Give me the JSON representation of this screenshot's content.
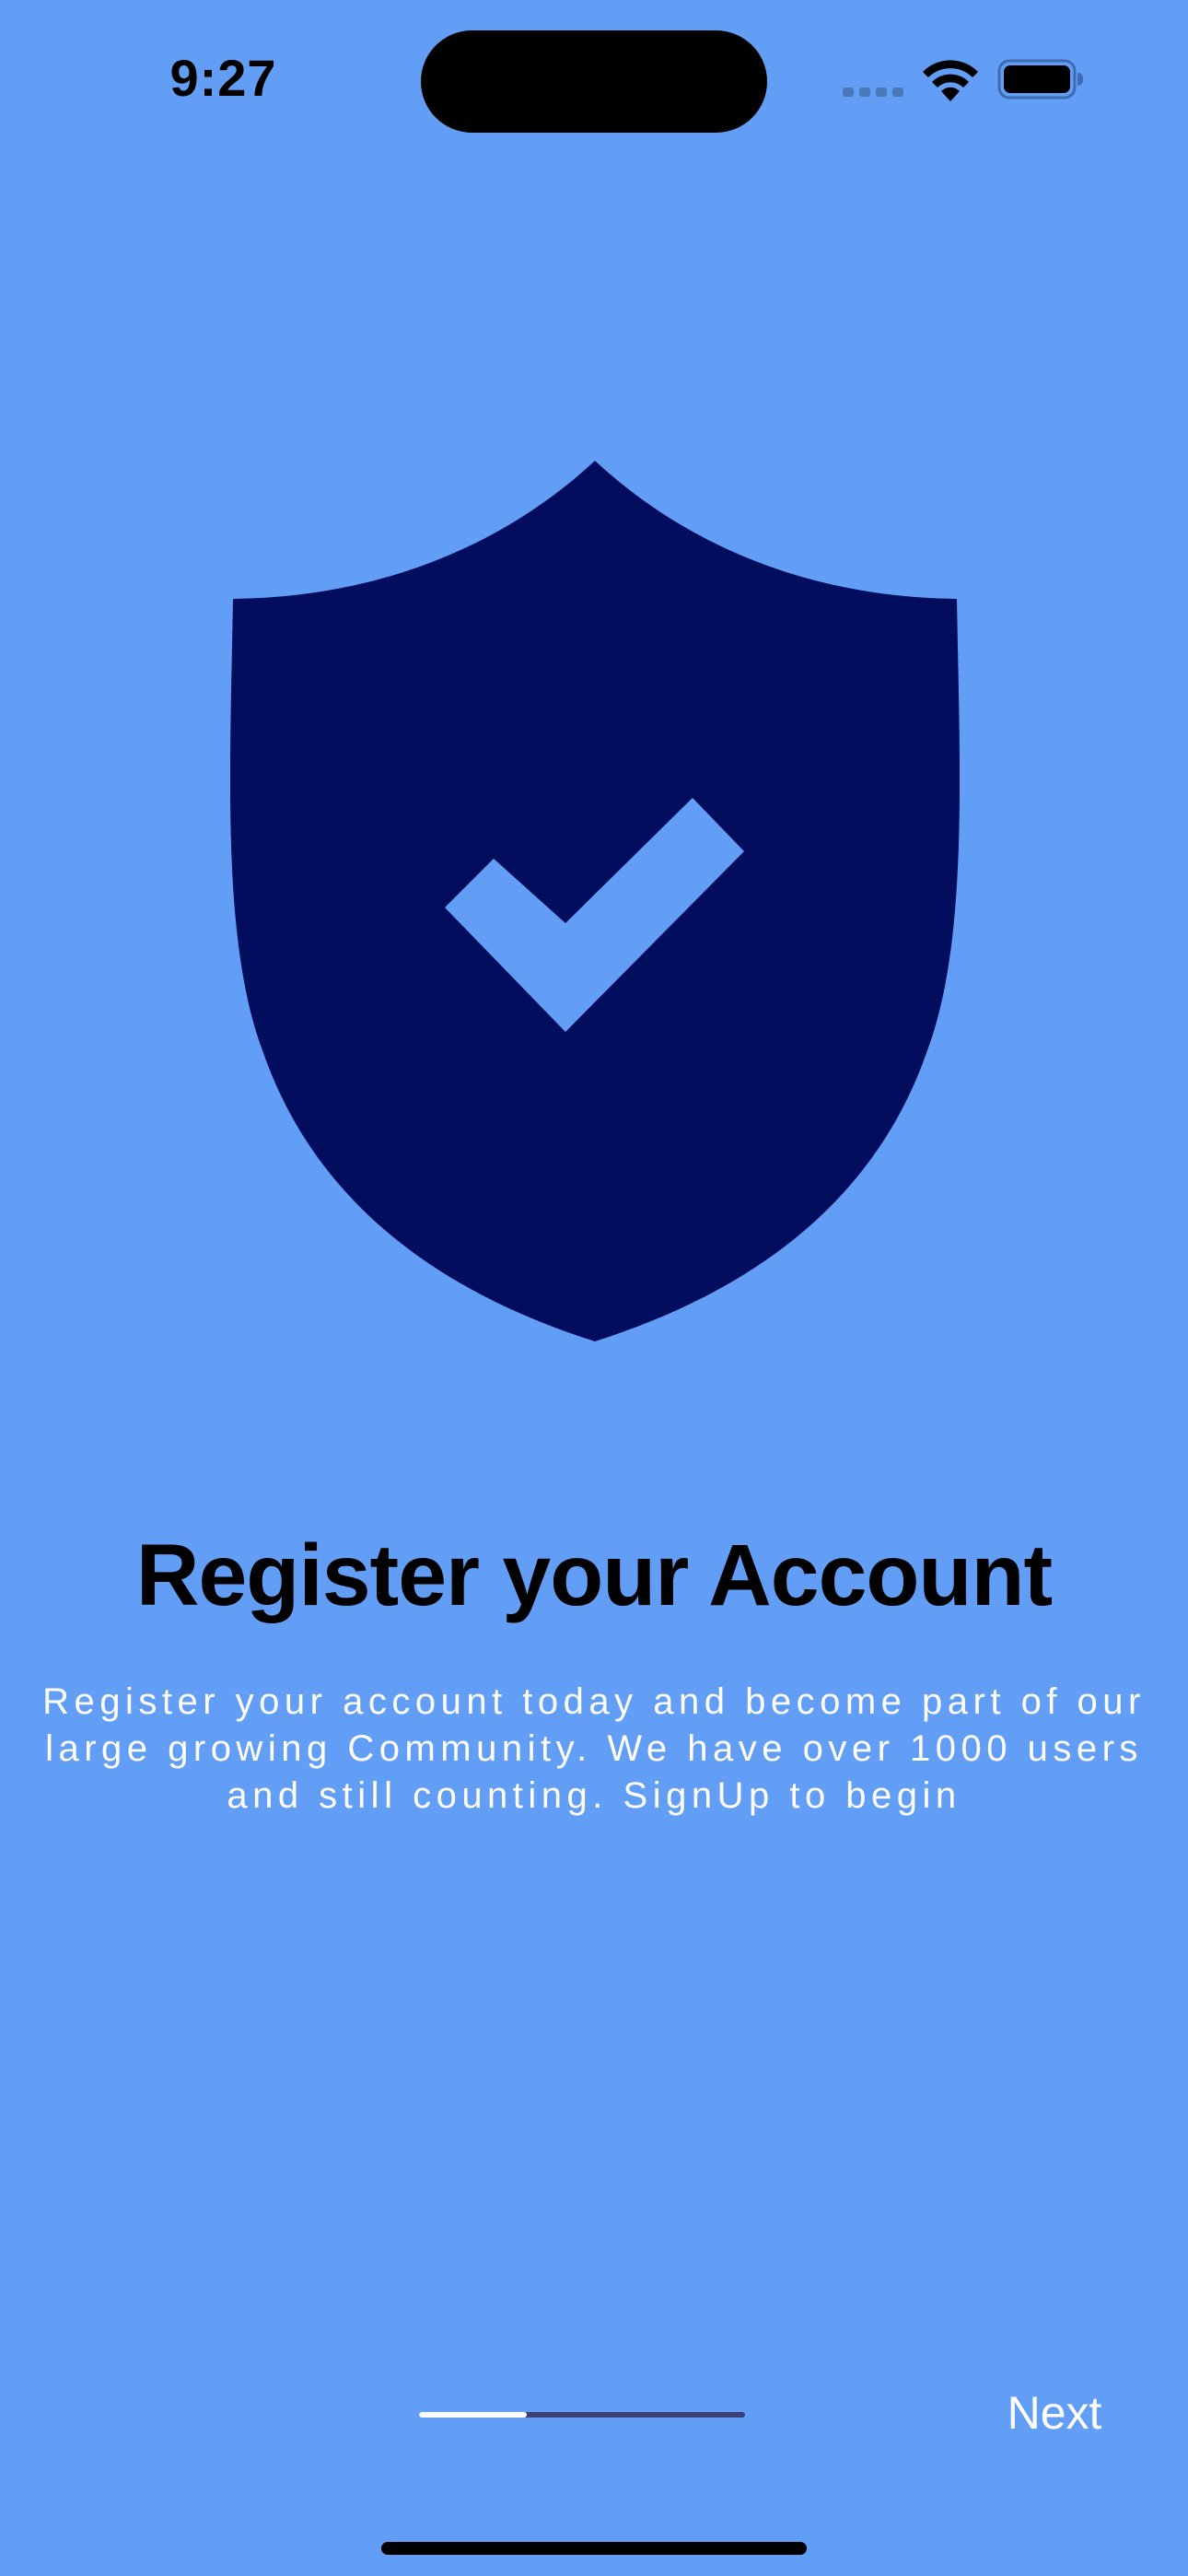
{
  "status_bar": {
    "time": "9:27",
    "icons": [
      "cellular-signal-icon",
      "wifi-icon",
      "battery-icon"
    ]
  },
  "illustration": {
    "icon": "shield-check-icon",
    "shield_color": "#030d5e",
    "check_color": "#629ef6"
  },
  "onboarding": {
    "title": "Register your Account",
    "description": "Register your account today and become part of our large growing Community. We have over 1000 users and still counting. SignUp to begin"
  },
  "pager": {
    "progress": 0.33,
    "next_label": "Next"
  },
  "colors": {
    "background": "#629ef6",
    "indicator_active": "#ffffff",
    "indicator_track": "#3d3f78"
  }
}
